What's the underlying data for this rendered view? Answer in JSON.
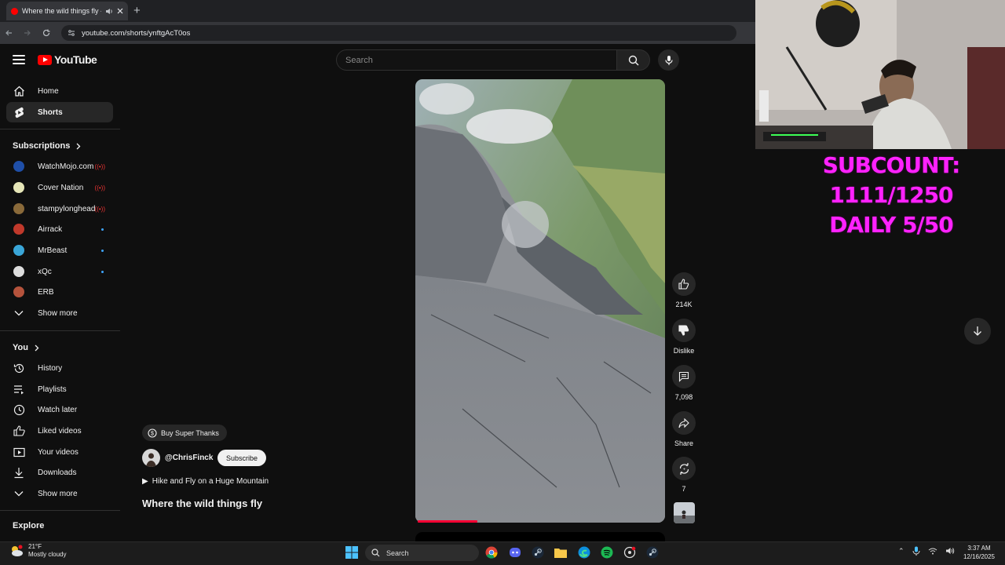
{
  "browser": {
    "tab_title": "Where the wild things fly -",
    "new_tab": "+",
    "url": "youtube.com/shorts/ynftgAcT0os"
  },
  "header": {
    "logo_text": "YouTube",
    "search_placeholder": "Search"
  },
  "sidebar": {
    "main": [
      {
        "label": "Home",
        "icon": "home-icon"
      },
      {
        "label": "Shorts",
        "icon": "shorts-icon",
        "active": true
      }
    ],
    "subscriptions_heading": "Subscriptions",
    "subscriptions": [
      {
        "label": "WatchMojo.com",
        "status": "live",
        "color": "#2a6fdb"
      },
      {
        "label": "Cover Nation",
        "status": "live",
        "color": "#e9e9c0"
      },
      {
        "label": "stampylonghead",
        "status": "live",
        "color": "#8a6a3a"
      },
      {
        "label": "Airrack",
        "status": "new",
        "color": "#c0392b"
      },
      {
        "label": "MrBeast",
        "status": "new",
        "color": "#3aa6d8"
      },
      {
        "label": "xQc",
        "status": "new",
        "color": "#dddddd"
      },
      {
        "label": "ERB",
        "status": "none",
        "color": "#b5533c"
      }
    ],
    "subs_show_more": "Show more",
    "you_heading": "You",
    "you_items": [
      {
        "label": "History",
        "icon": "history-icon"
      },
      {
        "label": "Playlists",
        "icon": "playlists-icon"
      },
      {
        "label": "Watch later",
        "icon": "watch-later-icon"
      },
      {
        "label": "Liked videos",
        "icon": "liked-videos-icon"
      },
      {
        "label": "Your videos",
        "icon": "your-videos-icon"
      },
      {
        "label": "Downloads",
        "icon": "downloads-icon"
      }
    ],
    "you_show_more": "Show more",
    "explore_heading": "Explore"
  },
  "short": {
    "buy_super_thanks": "Buy Super Thanks",
    "channel": "@ChrisFinck",
    "subscribe": "Subscribe",
    "music": "Hike and Fly on a Huge Mountain",
    "title": "Where the wild things fly",
    "progress": 0.24
  },
  "actions": {
    "likes": "214K",
    "dislike": "Dislike",
    "comments": "7,098",
    "share": "Share",
    "remix": "7"
  },
  "overlay": {
    "line1": "SUBCOUNT: 1111/1250",
    "line2": "DAILY 5/50"
  },
  "taskbar": {
    "weather_temp": "21°F",
    "weather_desc": "Mostly cloudy",
    "search": "Search",
    "time": "3:37 AM",
    "date": "12/16/2025"
  }
}
